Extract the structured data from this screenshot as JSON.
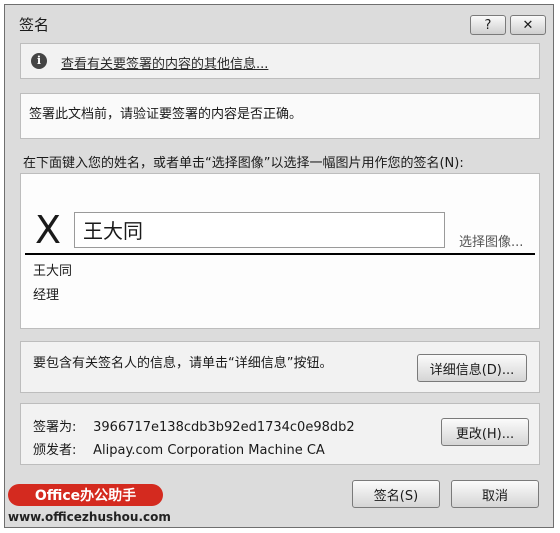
{
  "window": {
    "title": "签名"
  },
  "titlebar": {
    "help_label": "?",
    "close_label": "✕"
  },
  "info_bar": {
    "icon": "info-icon",
    "link_text": "查看有关要签署的内容的其他信息..."
  },
  "verify": {
    "text": "签署此文档前，请验证要签署的内容是否正确。"
  },
  "prompt": {
    "text": "在下面键入您的姓名，或者单击“选择图像”以选择一幅图片用作您的签名(N):"
  },
  "signature": {
    "x_mark": "X",
    "name_value": "王大同",
    "select_image_label": "选择图像...",
    "signer_name": "王大同",
    "signer_title": "经理"
  },
  "details": {
    "text": "要包含有关签名人的信息，请单击“详细信息”按钮。",
    "button_label": "详细信息(D)..."
  },
  "certificate": {
    "signed_as_label": "签署为:",
    "signed_as_value": "3966717e138cdb3b92ed1734c0e98db2",
    "issuer_label": "颁发者:",
    "issuer_value": "Alipay.com Corporation Machine CA",
    "change_label": "更改(H)..."
  },
  "footer": {
    "sign_label": "签名(S)",
    "cancel_label": "取消"
  },
  "watermark": {
    "badge": "Office办公助手",
    "url": "www.officezhushou.com"
  },
  "colors": {
    "dialog_bg": "#dcdcdc",
    "badge_red": "#d42a1f"
  }
}
